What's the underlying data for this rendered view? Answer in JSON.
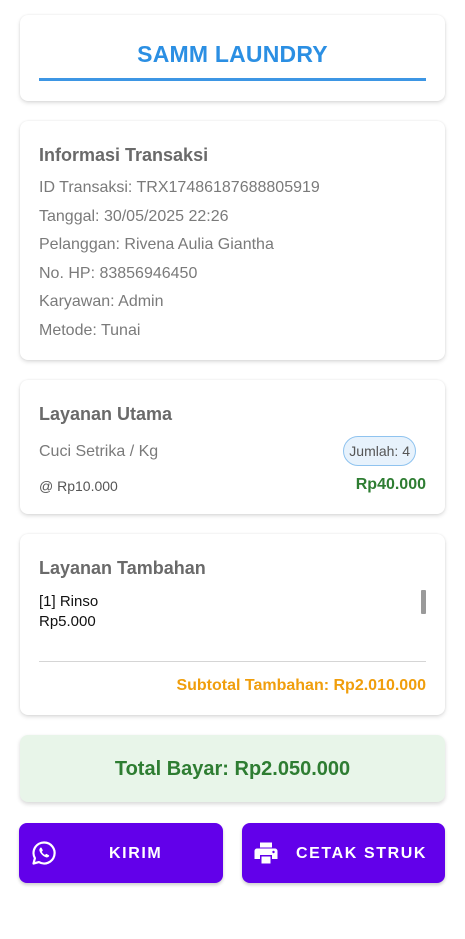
{
  "header": {
    "title": "SAMM LAUNDRY"
  },
  "transaction": {
    "title": "Informasi Transaksi",
    "lines": [
      "ID Transaksi: TRX17486187688805919",
      "Tanggal: 30/05/2025 22:26",
      "Pelanggan: Rivena Aulia Giantha",
      "No. HP: 83856946450",
      "Karyawan: Admin",
      "Metode: Tunai"
    ]
  },
  "main_service": {
    "title": "Layanan Utama",
    "name": "Cuci Setrika / Kg",
    "quantity_label": "Jumlah: 4",
    "unit_price": "@ Rp10.000",
    "line_total": "Rp40.000"
  },
  "extra_services": {
    "title": "Layanan Tambahan",
    "items": [
      {
        "name": "[1] Rinso",
        "price": "Rp5.000"
      }
    ],
    "subtotal": "Subtotal Tambahan: Rp2.010.000"
  },
  "total": {
    "label": "Total Bayar: Rp2.050.000"
  },
  "actions": {
    "send_label": "KIRIM",
    "send_icon": "whatsapp-icon",
    "print_label": "CETAK STRUK",
    "print_icon": "printer-icon"
  },
  "colors": {
    "accent_blue": "#2b8fe3",
    "button_purple": "#6200ea",
    "money_green": "#2e7d32",
    "subtotal_orange": "#f09e0c",
    "total_bg": "#e8f5e9"
  }
}
